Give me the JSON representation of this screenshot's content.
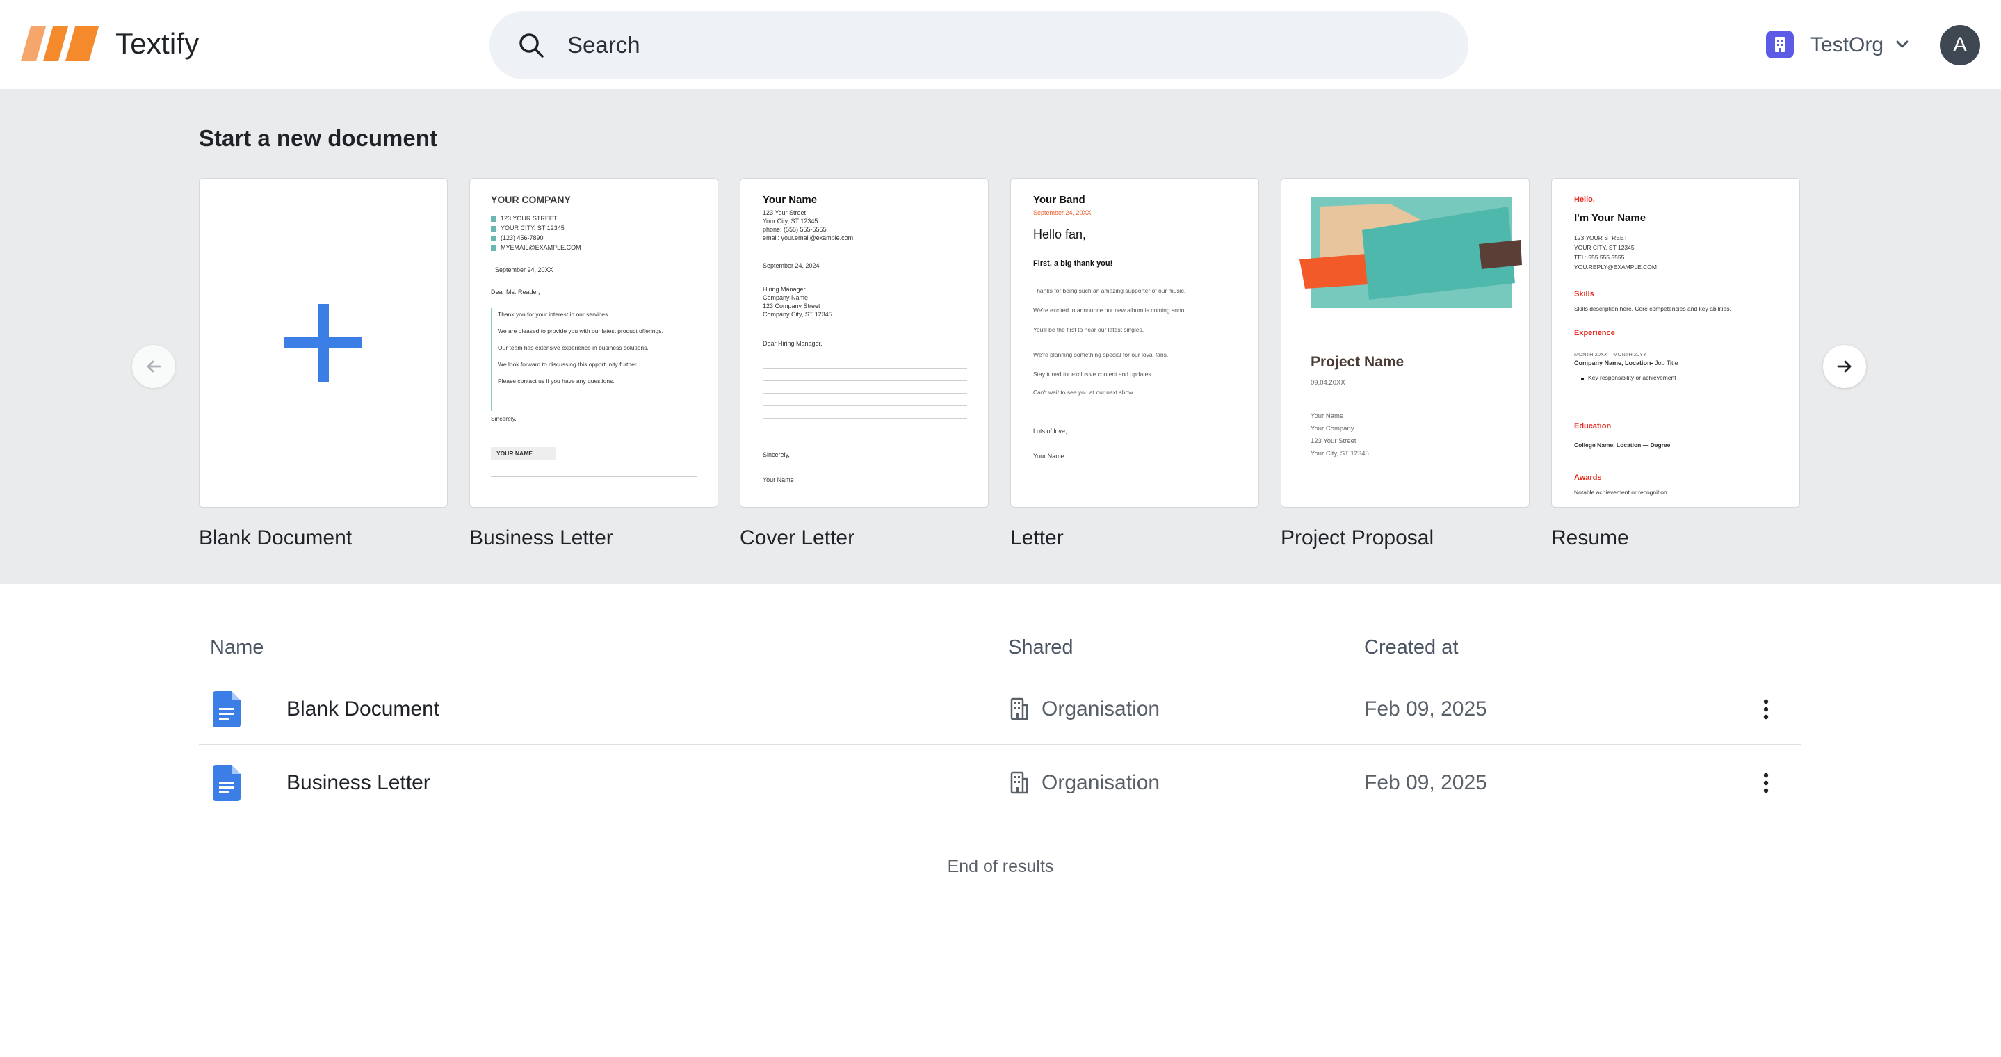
{
  "app": {
    "brand": "Textify",
    "accent": "#3b7fe6",
    "logo_color": "#f58a2d"
  },
  "search": {
    "placeholder": "Search"
  },
  "org": {
    "name": "TestOrg"
  },
  "user": {
    "avatar_initial": "A"
  },
  "templates": {
    "title": "Start a new document",
    "cards": [
      {
        "label": "Blank Document"
      },
      {
        "label": "Business Letter"
      },
      {
        "label": "Cover Letter"
      },
      {
        "label": "Letter"
      },
      {
        "label": "Project Proposal"
      },
      {
        "label": "Resume"
      }
    ]
  },
  "previews": {
    "business_letter": {
      "company": "YOUR COMPANY",
      "address": [
        "123 YOUR STREET",
        "YOUR CITY, ST 12345",
        "(123) 456-7890",
        "MYEMAIL@EXAMPLE.COM"
      ],
      "date": "September 24, 20XX",
      "greeting": "Dear Ms. Reader,",
      "body": [
        "Thank you for your interest in our services.",
        "We are pleased to provide you with our latest product offerings.",
        "Our team has extensive experience in business solutions.",
        "We look forward to discussing this opportunity further.",
        "Please contact us if you have any questions."
      ],
      "closing": "Sincerely,",
      "name": "YOUR NAME"
    },
    "cover_letter": {
      "name": "Your Name",
      "contact": [
        "123 Your Street",
        "Your City, ST 12345",
        "phone: (555) 555-5555",
        "email: your.email@example.com"
      ],
      "date": "September 24, 2024",
      "recipient": [
        "Hiring Manager",
        "Company Name",
        "123 Company Street",
        "Company City, ST 12345"
      ],
      "greeting": "Dear Hiring Manager,",
      "closing": "Sincerely,",
      "signature": "Your Name"
    },
    "letter": {
      "band": "Your Band",
      "date": "September 24, 20XX",
      "greeting": "Hello fan,",
      "headline": "First, a big thank you!",
      "body": [
        "Thanks for being such an amazing supporter of our music.",
        "We're excited to announce our new album is coming soon.",
        "You'll be the first to hear our latest singles.",
        "We're planning something special for our loyal fans.",
        "Stay tuned for exclusive content and updates.",
        "Can't wait to see you at our next show."
      ],
      "closing": "Lots of love,",
      "signature": "Your Name"
    },
    "proposal": {
      "title": "Project Name",
      "date": "09.04.20XX",
      "contact": [
        "Your Name",
        "Your Company",
        "123 Your Street",
        "Your City, ST 12345"
      ]
    },
    "resume": {
      "hello": "Hello,",
      "name": "I'm Your Name",
      "contact": [
        "123 YOUR STREET",
        "YOUR CITY, ST 12345",
        "TEL: 555.555.5555",
        "YOU.REPLY@EXAMPLE.COM"
      ],
      "skills_h": "Skills",
      "skills": "Skills description here. Core competencies and key abilities.",
      "exp_h": "Experience",
      "exp_dates": "MONTH 20XX – MONTH 20YY",
      "exp_role_bold": "Company Name, Location-",
      "exp_role": " Job Title",
      "exp_bullet": "Key responsibility or achievement",
      "edu_h": "Education",
      "edu": "College Name, Location — Degree",
      "awards_h": "Awards",
      "awards": "Notable achievement or recognition."
    }
  },
  "table": {
    "headers": {
      "name": "Name",
      "shared": "Shared",
      "created": "Created at"
    },
    "rows": [
      {
        "name": "Blank Document",
        "shared": "Organisation",
        "created": "Feb 09, 2025"
      },
      {
        "name": "Business Letter",
        "shared": "Organisation",
        "created": "Feb 09, 2025"
      }
    ],
    "end_text": "End of results"
  }
}
